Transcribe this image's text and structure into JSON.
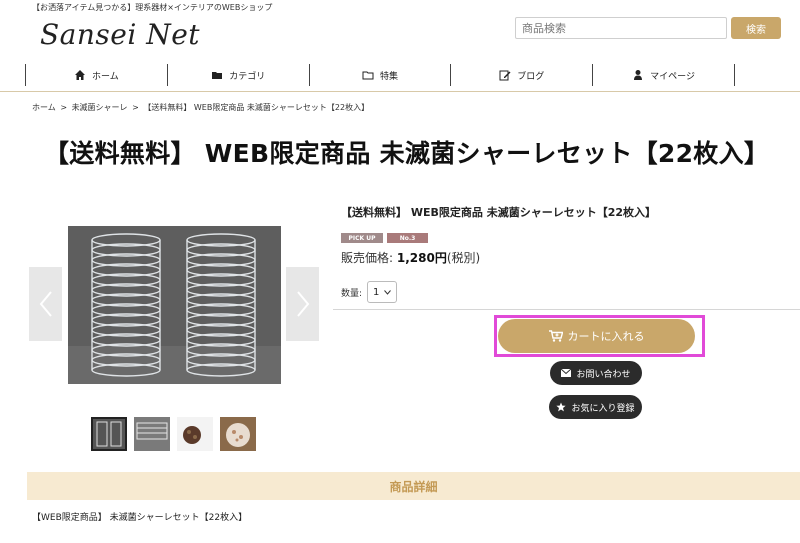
{
  "header": {
    "tagline": "【お洒落アイテム見つかる】理系器材×インテリアのWEBショップ",
    "logo": "Sansei Net",
    "search": {
      "placeholder": "商品検索",
      "button_label": "検索"
    }
  },
  "nav": {
    "items": [
      {
        "label": "ホーム",
        "icon": "home-icon"
      },
      {
        "label": "カテゴリ",
        "icon": "folder-icon"
      },
      {
        "label": "特集",
        "icon": "folder-open-icon"
      },
      {
        "label": "ブログ",
        "icon": "edit-icon"
      },
      {
        "label": "マイページ",
        "icon": "user-icon"
      }
    ]
  },
  "breadcrumb": {
    "items": [
      "ホーム",
      ">",
      "未滅菌シャーレ",
      ">",
      "【送料無料】 WEB限定商品 未滅菌シャーレセット【22枚入】"
    ]
  },
  "product": {
    "page_title": "【送料無料】 WEB限定商品 未滅菌シャーレセット【22枚入】",
    "detail_title": "【送料無料】 WEB限定商品 未滅菌シャーレセット【22枚入】",
    "badges": [
      "PICK UP",
      "No.3"
    ],
    "price_label": "販売価格:",
    "price_value": "1,280円",
    "price_tax": "(税別)",
    "quantity_label": "数量:",
    "quantity_value": "1",
    "cart_label": "カートに入れる",
    "contact_label": "お問い合わせ",
    "favorite_label": "お気に入り登録",
    "thumbnails_count_shown": 4
  },
  "section": {
    "details_heading": "商品詳細",
    "description": "【WEB限定商品】 未滅菌シャーレセット【22枚入】"
  },
  "colors": {
    "accent_gold": "#c9a76a",
    "highlight": "#e14ad8",
    "dark_button": "#2b2b2b",
    "section_bg": "#f7ead1"
  }
}
